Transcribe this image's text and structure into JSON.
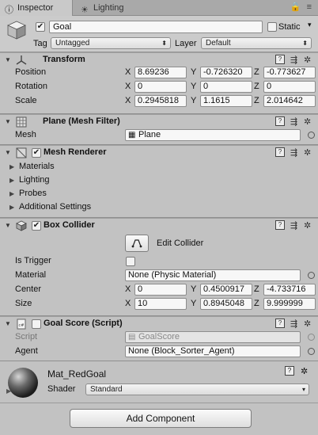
{
  "tabs": {
    "inspector": "Inspector",
    "lighting": "Lighting",
    "right_icons": "≡"
  },
  "gameobject": {
    "active": true,
    "name": "Goal",
    "static_label": "Static",
    "tag_label": "Tag",
    "tag_value": "Untagged",
    "layer_label": "Layer",
    "layer_value": "Default"
  },
  "transform": {
    "title": "Transform",
    "position_label": "Position",
    "rotation_label": "Rotation",
    "scale_label": "Scale",
    "axis": {
      "x": "X",
      "y": "Y",
      "z": "Z"
    },
    "position": {
      "x": "8.69236",
      "y": "-0.726320",
      "z": "-0.773627"
    },
    "rotation": {
      "x": "0",
      "y": "0",
      "z": "0"
    },
    "scale": {
      "x": "0.2945818",
      "y": "1.1615",
      "z": "2.014642"
    }
  },
  "mesh_filter": {
    "title": "Plane (Mesh Filter)",
    "mesh_label": "Mesh",
    "mesh_value": "Plane"
  },
  "mesh_renderer": {
    "title": "Mesh Renderer",
    "sections": [
      "Materials",
      "Lighting",
      "Probes",
      "Additional Settings"
    ]
  },
  "box_collider": {
    "title": "Box Collider",
    "edit_label": "Edit Collider",
    "is_trigger_label": "Is Trigger",
    "material_label": "Material",
    "material_value": "None (Physic Material)",
    "center_label": "Center",
    "size_label": "Size",
    "center": {
      "x": "0",
      "y": "0.4500917",
      "z": "-4.733716"
    },
    "size": {
      "x": "10",
      "y": "0.8945048",
      "z": "9.999999"
    }
  },
  "goal_script": {
    "title": "Goal Score (Script)",
    "script_label": "Script",
    "script_value": "GoalScore",
    "agent_label": "Agent",
    "agent_value": "None (Block_Sorter_Agent)"
  },
  "material": {
    "name": "Mat_RedGoal",
    "shader_label": "Shader",
    "shader_value": "Standard"
  },
  "add_component": "Add Component",
  "colors": {
    "panel_bg": "#c2c2c2",
    "tab_bg": "#a9a9a9",
    "field_bg": "#f7f7f7"
  }
}
